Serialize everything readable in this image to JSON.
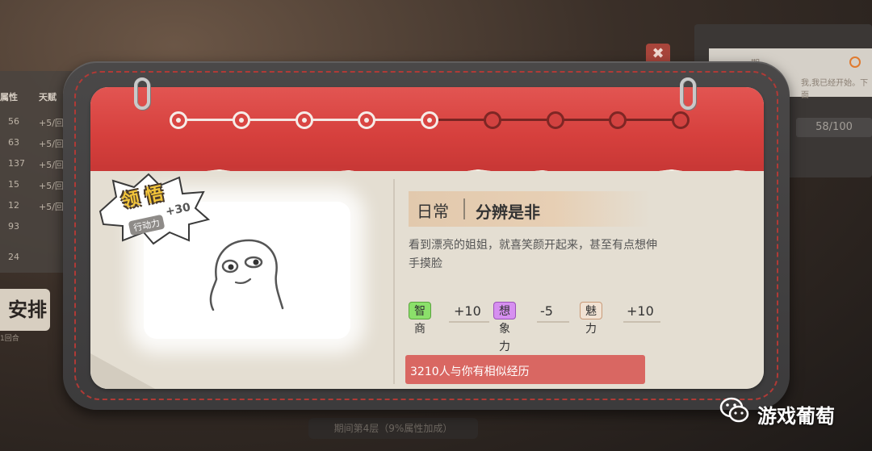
{
  "background": {
    "left_header": [
      "属性",
      "天赋"
    ],
    "left_rows": [
      {
        "value": "56",
        "bonus": "+5/回"
      },
      {
        "value": "63",
        "bonus": "+5/回"
      },
      {
        "value": "137",
        "bonus": "+5/回"
      },
      {
        "value": "15",
        "bonus": "+5/回"
      },
      {
        "value": "12",
        "bonus": "+5/回"
      },
      {
        "value": "93",
        "bonus": ""
      },
      {
        "value": "24",
        "bonus": ""
      }
    ],
    "left_button": "安排",
    "left_small": "1回合",
    "right_text1": "期",
    "right_text2": "我,我已经开始。下面",
    "right_bar": "58/100",
    "close_label": "✖",
    "bottom_bar": "期间第4层（9%属性加成）"
  },
  "progress": {
    "total": 9,
    "completed": 5
  },
  "badge": {
    "title": "领悟",
    "tag": "行动力",
    "value": "+30"
  },
  "event": {
    "category": "日常",
    "title": "分辨是非",
    "description": "看到漂亮的姐姐，就喜笑颜开起来，甚至有点想伸手摸脸"
  },
  "stats": [
    {
      "label": "智商",
      "value": "+10",
      "color": "#8be06a",
      "border": "#5aa43e"
    },
    {
      "label": "想象力",
      "value": "-5",
      "color": "#d68ff0",
      "border": "#9b53b8"
    },
    {
      "label": "魅力",
      "value": "+10",
      "color": "#f1e2d3",
      "border": "#c99a78"
    }
  ],
  "similar_text": "3210人与你有相似经历",
  "watermark": "游戏葡萄"
}
